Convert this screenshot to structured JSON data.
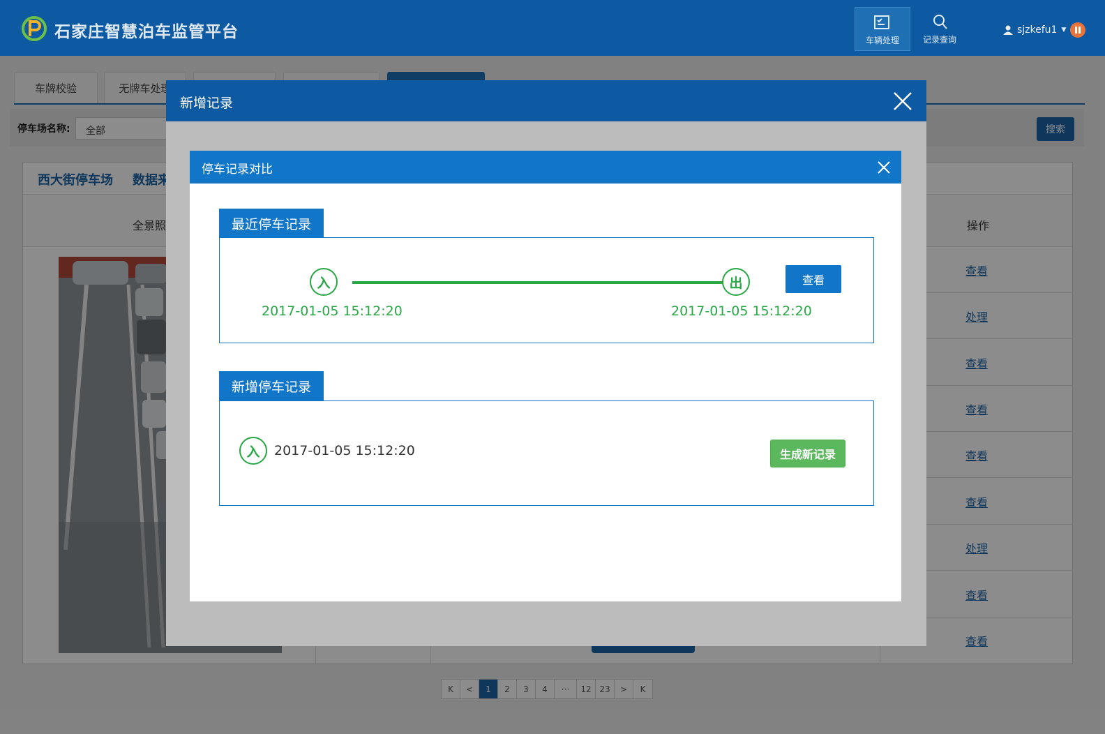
{
  "header": {
    "app_title": "石家庄智慧泊车监管平台",
    "nav": [
      {
        "label": "车辆处理",
        "icon": "vehicle-process-icon",
        "active": true
      },
      {
        "label": "记录查询",
        "icon": "record-search-icon",
        "active": false
      }
    ],
    "username": "sjzkefu1",
    "brand_color": "#0d5aa2"
  },
  "page": {
    "tabs": [
      "车牌校验",
      "无牌车处理",
      "",
      "",
      ""
    ],
    "filter": {
      "label": "停车场名称:",
      "select_value": "全部",
      "search_label": "搜索"
    },
    "panel_tabs": [
      "西大街停车场",
      "数据来"
    ],
    "columns": {
      "photo": "全景照",
      "operation": "操作"
    },
    "operations": [
      "查看",
      "处理",
      "查看",
      "查看",
      "查看",
      "查看",
      "处理",
      "查看",
      "查看"
    ],
    "pagination": [
      "K",
      "<",
      "1",
      "2",
      "3",
      "4",
      "···",
      "12",
      "23",
      ">",
      "K"
    ],
    "current_page": "1"
  },
  "outer_modal": {
    "title": "新增记录"
  },
  "inner_modal": {
    "title": "停车记录对比",
    "recent": {
      "label": "最近停车记录",
      "entry_badge": "入",
      "exit_badge": "出",
      "entry_time": "2017-01-05 15:12:20",
      "exit_time": "2017-01-05 15:12:20",
      "view_label": "查看"
    },
    "new_record": {
      "label": "新增停车记录",
      "entry_badge": "入",
      "entry_time": "2017-01-05 15:12:20",
      "generate_label": "生成新记录"
    },
    "accent_color": "#1176c8",
    "success_color": "#28a745"
  }
}
